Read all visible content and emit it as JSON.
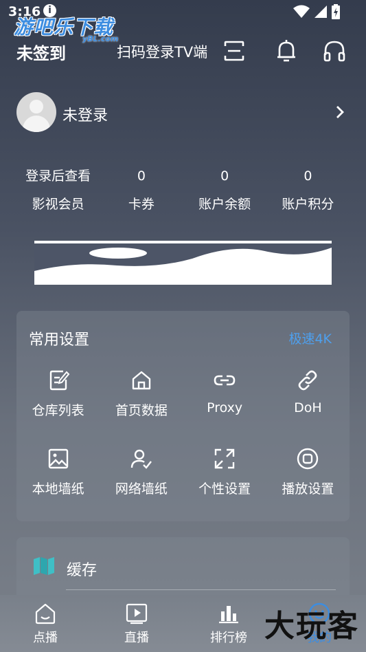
{
  "status_bar": {
    "time": "3:16",
    "info_glyph": "i",
    "icons": [
      "wifi-icon",
      "cell-signal-icon",
      "battery-icon"
    ]
  },
  "watermark": {
    "main": "游吧乐下载",
    "sub": "yBL.com"
  },
  "header": {
    "sign_status": "未签到",
    "scan_tv": "扫码登录TV端",
    "icons": [
      "scan-icon",
      "bell-icon",
      "headset-icon"
    ]
  },
  "profile": {
    "name": "未登录"
  },
  "stats": [
    {
      "value": "登录后查看",
      "label": "影视会员"
    },
    {
      "value": "0",
      "label": "卡券"
    },
    {
      "value": "0",
      "label": "账户余额"
    },
    {
      "value": "0",
      "label": "账户积分"
    }
  ],
  "settings": {
    "title": "常用设置",
    "accent_link": "极速4K",
    "accent_color": "#4ea0ee",
    "items": [
      {
        "label": "仓库列表",
        "icon": "edit-document-icon"
      },
      {
        "label": "首页数据",
        "icon": "home-icon"
      },
      {
        "label": "Proxy",
        "icon": "link-icon"
      },
      {
        "label": "DoH",
        "icon": "chain-link-icon"
      },
      {
        "label": "本地墙纸",
        "icon": "image-icon"
      },
      {
        "label": "网络墙纸",
        "icon": "user-check-icon"
      },
      {
        "label": "个性设置",
        "icon": "expand-icon"
      },
      {
        "label": "播放设置",
        "icon": "stop-circle-icon"
      }
    ]
  },
  "cache": {
    "label": "缓存",
    "icon": "map-icon",
    "icon_color": "#3fbfc6"
  },
  "bottom_nav": [
    {
      "label": "点播",
      "icon": "home-outline-icon"
    },
    {
      "label": "直播",
      "icon": "play-square-icon"
    },
    {
      "label": "排行榜",
      "icon": "bar-chart-icon"
    },
    {
      "label": "我的",
      "icon": "smile-icon"
    }
  ],
  "corner_mark": "大玩客"
}
